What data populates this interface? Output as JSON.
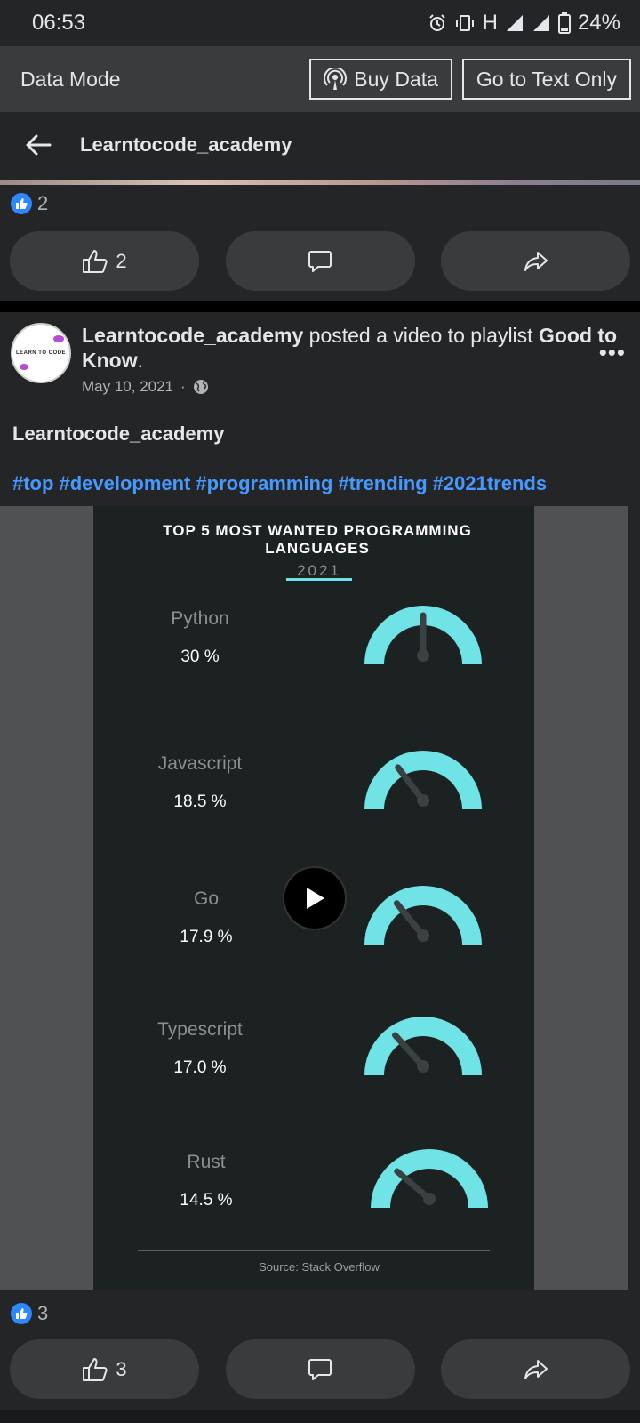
{
  "status": {
    "time": "06:53",
    "network": "H",
    "battery": "24%"
  },
  "datamode": {
    "label": "Data Mode",
    "buy_label": "Buy Data",
    "text_only_label": "Go to Text Only"
  },
  "nav": {
    "title": "Learntocode_academy"
  },
  "prev_post": {
    "reaction_count": "2",
    "like_count": "2"
  },
  "post": {
    "author": "Learntocode_academy",
    "action_text": "posted a video to playlist",
    "playlist": "Good to Know",
    "date": "May 10, 2021",
    "more": "•••",
    "body_title": "Learntocode_academy",
    "hashtags": [
      "#top",
      "#development",
      "#programming",
      "#trending",
      "#2021trends"
    ],
    "reaction_count": "3",
    "like_count": "3",
    "avatar_text": "LEARN TO CODE"
  },
  "chart_data": {
    "type": "gauge",
    "title": "TOP 5 MOST WANTED PROGRAMMING LANGUAGES",
    "subtitle": "2021",
    "categories": [
      "Python",
      "Javascript",
      "Go",
      "Typescript",
      "Rust"
    ],
    "values": [
      30,
      18.5,
      17.9,
      17.0,
      14.5
    ],
    "value_labels": [
      "30 %",
      "18.5 %",
      "17.9 %",
      "17.0 %",
      "14.5 %"
    ],
    "source": "Source: Stack Overflow",
    "gauge_color": "#6fe3e6"
  },
  "colors": {
    "link": "#4599ff",
    "like": "#2d88ff",
    "surface": "#242526",
    "button": "#3a3b3c"
  }
}
